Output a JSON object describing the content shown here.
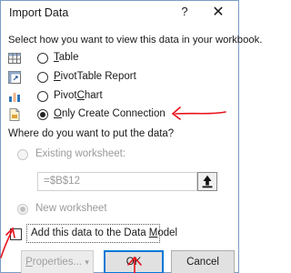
{
  "dialog": {
    "title": "Import Data",
    "help_symbol": "?",
    "close_symbol": "✕"
  },
  "view_section": {
    "prompt": "Select how you want to view this data in your workbook.",
    "options": [
      {
        "label_pre": "",
        "accel": "T",
        "label_post": "able",
        "selected": false,
        "icon": "table-icon"
      },
      {
        "label_pre": "",
        "accel": "P",
        "label_post": "ivotTable Report",
        "selected": false,
        "icon": "pivottable-icon"
      },
      {
        "label_pre": "Pivot",
        "accel": "C",
        "label_post": "hart",
        "selected": false,
        "icon": "pivotchart-icon"
      },
      {
        "label_pre": "",
        "accel": "O",
        "label_post": "nly Create Connection",
        "selected": true,
        "icon": "connection-icon"
      }
    ]
  },
  "location_section": {
    "prompt": "Where do you want to put the data?",
    "existing_label": "Existing worksheet:",
    "cell_reference": "=$B$12",
    "new_label": "New worksheet"
  },
  "data_model": {
    "label_pre": "Add this data to the Data ",
    "accel": "M",
    "label_post": "odel",
    "checked": false
  },
  "buttons": {
    "properties_pre": "",
    "properties_accel": "P",
    "properties_post": "roperties...",
    "properties_arrow": "▾",
    "ok": "OK",
    "cancel": "Cancel"
  },
  "colors": {
    "annotation": "#e8121c",
    "focus_border": "#0078d7"
  }
}
